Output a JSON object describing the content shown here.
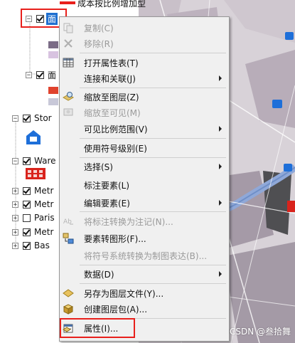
{
  "toc": {
    "top_legend_label": "成本按比例增加型",
    "layer_partial_a": "面",
    "layer_partial_b": "面",
    "layers": [
      {
        "label": "Stor",
        "checked": true
      },
      {
        "label": "Ware",
        "checked": true
      },
      {
        "label": "Metr",
        "checked": true
      },
      {
        "label": "Metr",
        "checked": true
      },
      {
        "label": "Paris",
        "checked": false
      },
      {
        "label": "Metr",
        "checked": true
      },
      {
        "label": "Bas",
        "checked": true
      }
    ]
  },
  "context_menu": {
    "items": [
      {
        "label": "复制(C)",
        "icon": "copy-icon",
        "disabled": true
      },
      {
        "label": "移除(R)",
        "icon": "remove-icon",
        "disabled": true
      },
      {
        "label": "打开属性表(T)",
        "icon": "table-icon",
        "disabled": false
      },
      {
        "label": "连接和关联(J)",
        "icon": "",
        "disabled": false,
        "submenu": true
      },
      {
        "label": "缩放至图层(Z)",
        "icon": "zoom-layer-icon",
        "disabled": false
      },
      {
        "label": "缩放至可见(M)",
        "icon": "zoom-visible-icon",
        "disabled": true
      },
      {
        "label": "可见比例范围(V)",
        "icon": "",
        "disabled": false,
        "submenu": true
      },
      {
        "label": "使用符号级别(E)",
        "icon": "",
        "disabled": false
      },
      {
        "label": "选择(S)",
        "icon": "",
        "disabled": false,
        "submenu": true
      },
      {
        "label": "标注要素(L)",
        "icon": "",
        "disabled": false
      },
      {
        "label": "编辑要素(E)",
        "icon": "",
        "disabled": false,
        "submenu": true
      },
      {
        "label": "将标注转换为注记(N)...",
        "icon": "convert-annotation-icon",
        "disabled": true
      },
      {
        "label": "要素转图形(F)...",
        "icon": "feature-to-graphic-icon",
        "disabled": false
      },
      {
        "label": "将符号系统转换为制图表达(B)...",
        "icon": "",
        "disabled": true
      },
      {
        "label": "数据(D)",
        "icon": "",
        "disabled": false,
        "submenu": true
      },
      {
        "label": "另存为图层文件(Y)...",
        "icon": "save-layer-icon",
        "disabled": false
      },
      {
        "label": "创建图层包(A)...",
        "icon": "layer-package-icon",
        "disabled": false
      },
      {
        "label": "属性(I)...",
        "icon": "properties-icon",
        "disabled": false
      }
    ]
  },
  "watermark": "CSDN @叁拾舞",
  "colors": {
    "highlight_red": "#e8201c",
    "map_bg": "#d6cfd4",
    "store_blue": "#1e6fd9",
    "warehouse_red": "#d9231c"
  }
}
